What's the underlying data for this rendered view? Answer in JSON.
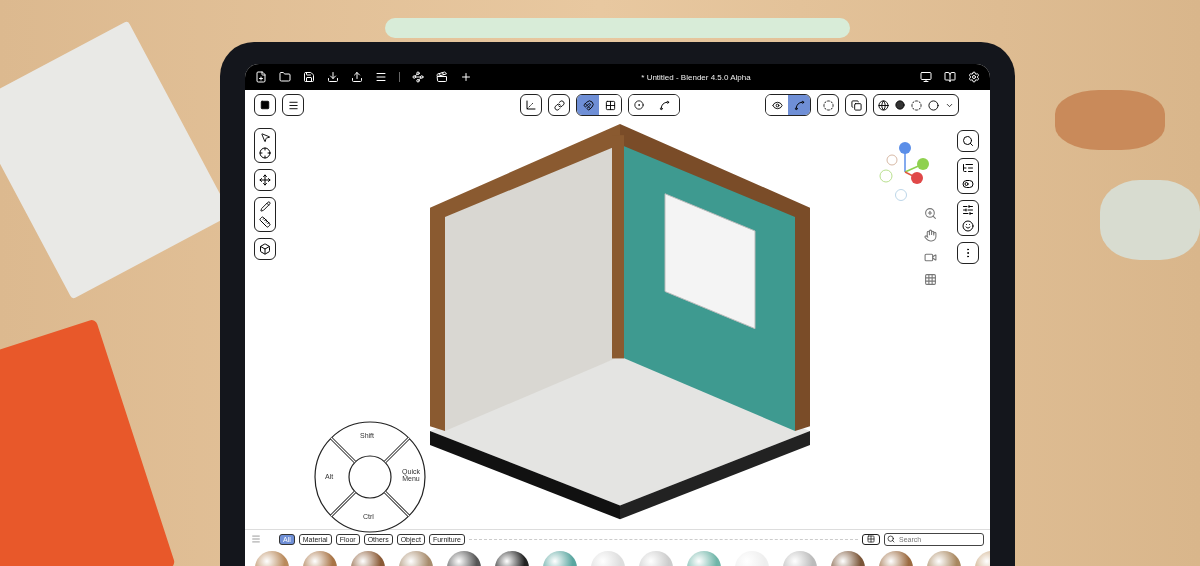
{
  "title": "* Untitled - Blender 4.5.0 Alpha",
  "snap_toggles": [
    {
      "selected": true
    },
    {
      "selected": false
    }
  ],
  "overlay_toggles": [
    {
      "selected": false
    },
    {
      "selected": true
    }
  ],
  "pie_menu": {
    "top": "Shift",
    "left": "Alt",
    "right": "Quick Menu",
    "bottom": "Ctrl"
  },
  "asset_tabs": [
    {
      "label": "All",
      "selected": true
    },
    {
      "label": "Material",
      "selected": false
    },
    {
      "label": "Floor",
      "selected": false
    },
    {
      "label": "Others",
      "selected": false
    },
    {
      "label": "Object",
      "selected": false
    },
    {
      "label": "Furniture",
      "selected": false
    }
  ],
  "search": {
    "placeholder": "Search"
  }
}
